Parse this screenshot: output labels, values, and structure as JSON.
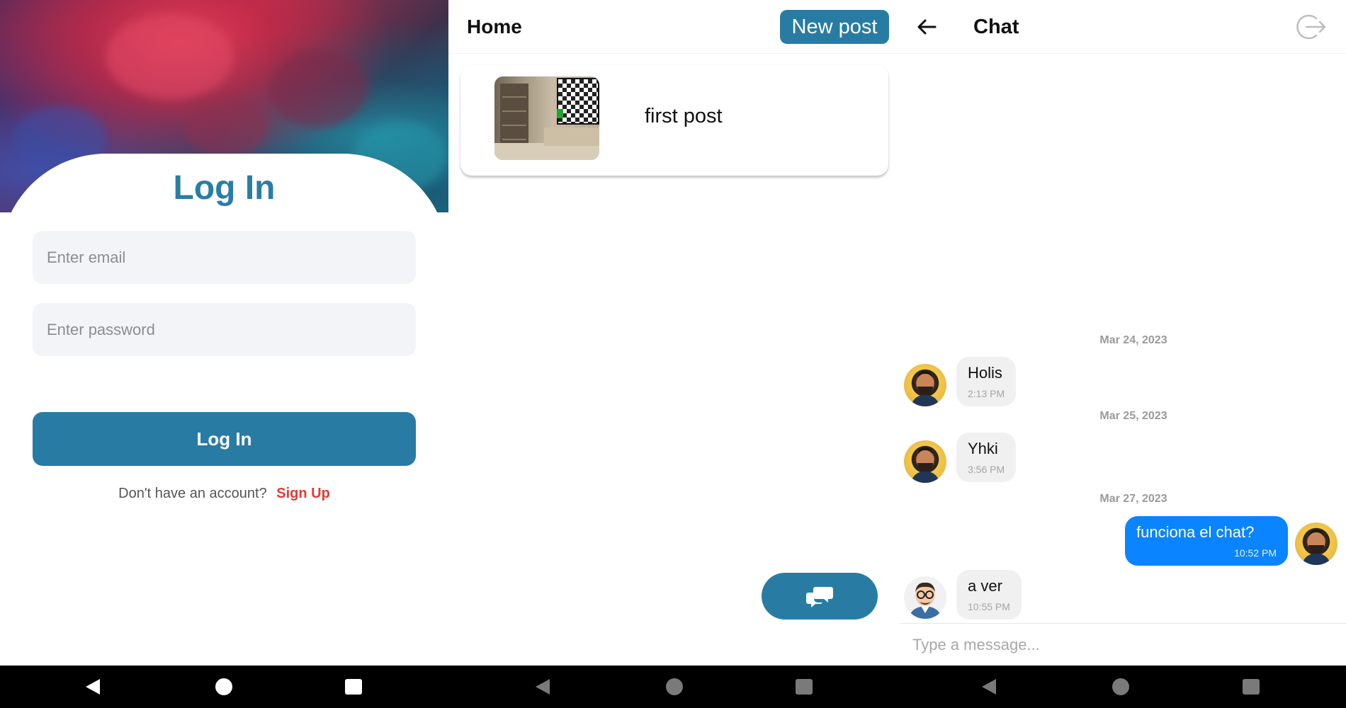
{
  "login": {
    "title": "Log In",
    "email_placeholder": "Enter email",
    "password_placeholder": "Enter password",
    "button_label": "Log In",
    "signup_prompt": "Don't have an account?",
    "signup_link": "Sign Up"
  },
  "home": {
    "title": "Home",
    "new_post_label": "New post",
    "posts": [
      {
        "text": "first post"
      }
    ],
    "fab_icon": "chat-bubbles-icon"
  },
  "chat": {
    "title": "Chat",
    "back_icon": "arrow-left-icon",
    "logout_icon": "logout-icon",
    "messages": [
      {
        "date": "Mar 24, 2023",
        "text": "Holis",
        "time": "2:13 PM",
        "direction": "incoming"
      },
      {
        "date": "Mar 25, 2023",
        "text": "Yhki",
        "time": "3:56 PM",
        "direction": "incoming"
      },
      {
        "date": "Mar 27, 2023",
        "text": "funciona el chat?",
        "time": "10:52 PM",
        "direction": "outgoing"
      },
      {
        "date": "",
        "text": "a ver",
        "time": "10:55 PM",
        "direction": "incoming"
      }
    ],
    "input_placeholder": "Type a message..."
  },
  "colors": {
    "primary": "#287ca4",
    "signup_link": "#e53935",
    "outgoing_bubble": "#0a84ff",
    "incoming_bubble": "#f0f0f0"
  }
}
